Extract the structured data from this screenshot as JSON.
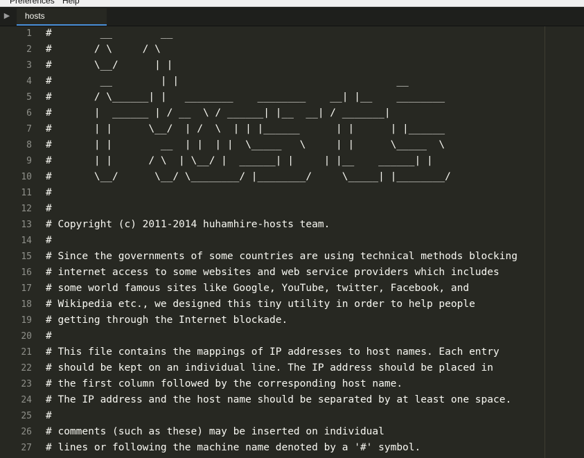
{
  "menubar": {
    "items": [
      "Preferences",
      "Help"
    ]
  },
  "tabs": [
    {
      "label": "hosts",
      "active": true
    }
  ],
  "editor": {
    "lines": [
      {
        "number": "1",
        "text": "#        __        __"
      },
      {
        "number": "2",
        "text": "#       / \\     / \\"
      },
      {
        "number": "3",
        "text": "#       \\__/      | |"
      },
      {
        "number": "4",
        "text": "#        __        | |                                    __"
      },
      {
        "number": "5",
        "text": "#       / \\______| |   ________    ________    __| |__    ________"
      },
      {
        "number": "6",
        "text": "#       |  ______ | / __  \\ / ______| |__  __| / _______|"
      },
      {
        "number": "7",
        "text": "#       | |      \\__/  | /  \\  | | |______      | |      | |______"
      },
      {
        "number": "8",
        "text": "#       | |        __  | |  | |  \\_____   \\     | |      \\_____  \\"
      },
      {
        "number": "9",
        "text": "#       | |      / \\  | \\__/ |  ______| |     | |__    ______| |"
      },
      {
        "number": "10",
        "text": "#       \\__/      \\__/ \\________/ |________/     \\_____| |________/"
      },
      {
        "number": "11",
        "text": "#"
      },
      {
        "number": "12",
        "text": "#"
      },
      {
        "number": "13",
        "text": "# Copyright (c) 2011-2014 huhamhire-hosts team."
      },
      {
        "number": "14",
        "text": "#"
      },
      {
        "number": "15",
        "text": "# Since the governments of some countries are using technical methods blocking"
      },
      {
        "number": "16",
        "text": "# internet access to some websites and web service providers which includes"
      },
      {
        "number": "17",
        "text": "# some world famous sites like Google, YouTube, twitter, Facebook, and"
      },
      {
        "number": "18",
        "text": "# Wikipedia etc., we designed this tiny utility in order to help people"
      },
      {
        "number": "19",
        "text": "# getting through the Internet blockade."
      },
      {
        "number": "20",
        "text": "#"
      },
      {
        "number": "21",
        "text": "# This file contains the mappings of IP addresses to host names. Each entry"
      },
      {
        "number": "22",
        "text": "# should be kept on an individual line. The IP address should be placed in"
      },
      {
        "number": "23",
        "text": "# the first column followed by the corresponding host name."
      },
      {
        "number": "24",
        "text": "# The IP address and the host name should be separated by at least one space."
      },
      {
        "number": "25",
        "text": "#"
      },
      {
        "number": "26",
        "text": "# comments (such as these) may be inserted on individual"
      },
      {
        "number": "27",
        "text": "# lines or following the machine name denoted by a '#' symbol."
      }
    ]
  }
}
